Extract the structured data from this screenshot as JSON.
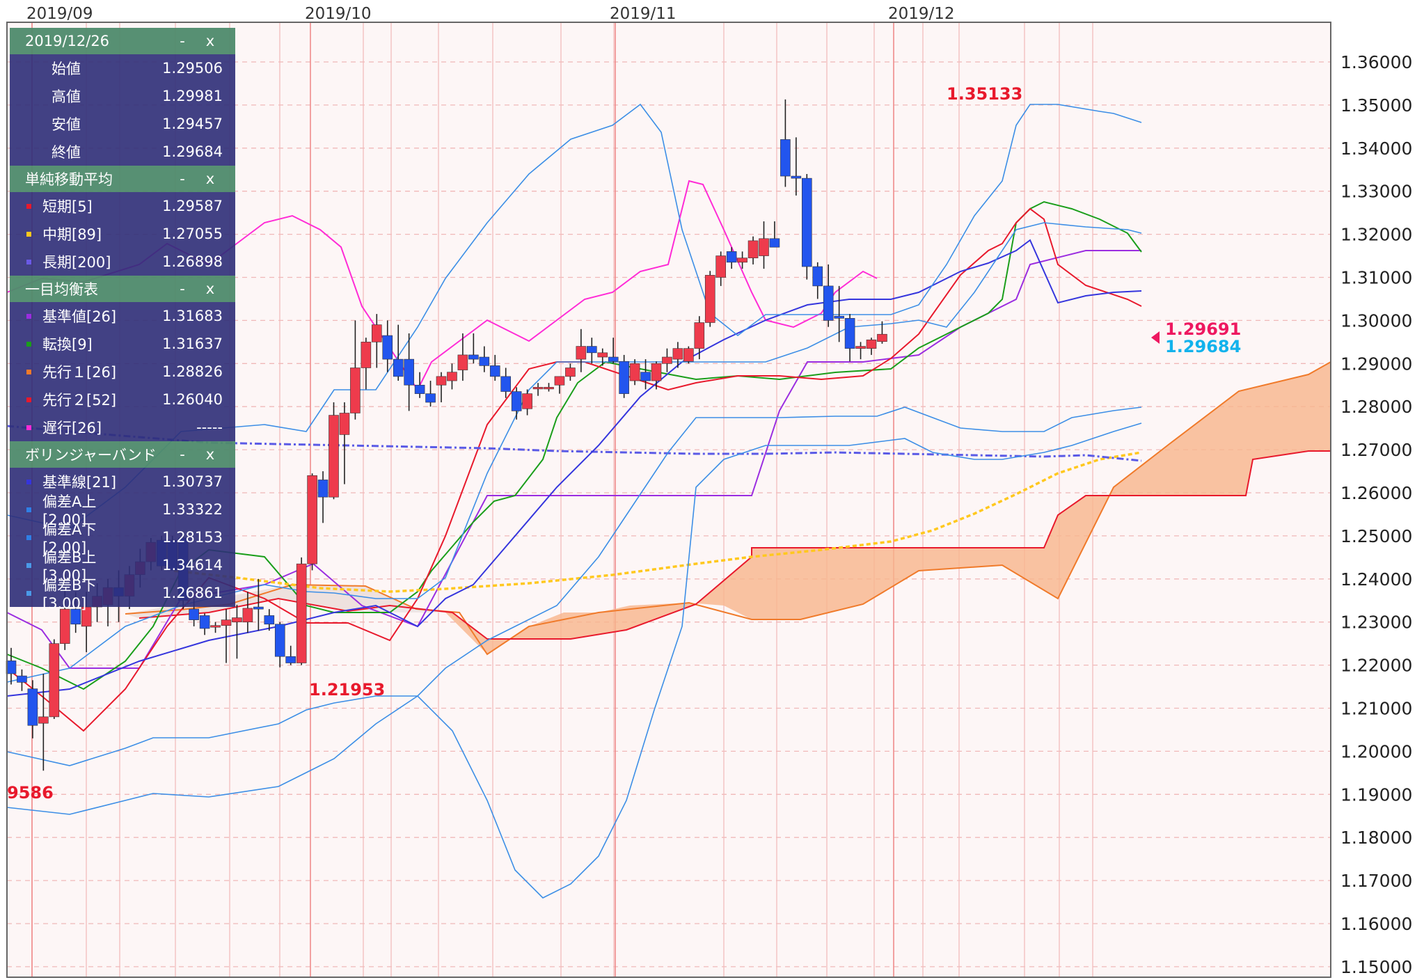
{
  "price_axis": {
    "ticks": [
      "1.36000",
      "1.35000",
      "1.34000",
      "1.33000",
      "1.32000",
      "1.31000",
      "1.30000",
      "1.29000",
      "1.28000",
      "1.27000",
      "1.26000",
      "1.25000",
      "1.24000",
      "1.23000",
      "1.22000",
      "1.21000",
      "1.20000",
      "1.19000",
      "1.18000",
      "1.17000",
      "1.16000",
      "1.15000"
    ]
  },
  "date_axis": {
    "labels": [
      "2019/09",
      "2019/10",
      "2019/11",
      "2019/12"
    ]
  },
  "annotations": {
    "high_label": "1.35133",
    "low_label": "1.21953",
    "left_low_label": "9586",
    "price_top": "1.29691",
    "price_bottom": "1.29684"
  },
  "colors": {
    "up_candle": "#ee3b4c",
    "down_candle": "#2255ee",
    "sma_short": "#e8192c",
    "sma_mid": "#ffc81e",
    "sma_long": "#5a5ae6",
    "kijun": "#9b2de0",
    "tenkan": "#1a9e1a",
    "senkou1": "#f07a2a",
    "senkou2": "#e8192c",
    "chikou": "#ff2bd6",
    "bb_basis": "#3535dd",
    "bb_band": "#3c8ee6",
    "cloud": "#f7b58c",
    "price_top": "#ee1860",
    "price_bottom": "#12b2ec"
  },
  "legend": {
    "ohlc": {
      "title": "2019/12/26",
      "rows": [
        {
          "label": "始値",
          "value": "1.29506"
        },
        {
          "label": "高値",
          "value": "1.29981"
        },
        {
          "label": "安値",
          "value": "1.29457"
        },
        {
          "label": "終値",
          "value": "1.29684"
        }
      ]
    },
    "sma": {
      "title": "単純移動平均",
      "rows": [
        {
          "label": "短期[5]",
          "value": "1.29587",
          "color": "#e8192c"
        },
        {
          "label": "中期[89]",
          "value": "1.27055",
          "color": "#ffc81e"
        },
        {
          "label": "長期[200]",
          "value": "1.26898",
          "color": "#6a5ae6"
        }
      ]
    },
    "ichimoku": {
      "title": "一目均衡表",
      "rows": [
        {
          "label": "基準値[26]",
          "value": "1.31683",
          "color": "#9b2de0"
        },
        {
          "label": "転換[9]",
          "value": "1.31637",
          "color": "#1a9e1a"
        },
        {
          "label": "先行１[26]",
          "value": "1.28826",
          "color": "#f07a2a"
        },
        {
          "label": "先行２[52]",
          "value": "1.26040",
          "color": "#e8192c"
        },
        {
          "label": "遅行[26]",
          "value": "-----",
          "color": "#ff2bd6"
        }
      ]
    },
    "bollinger": {
      "title": "ボリンジャーバンド",
      "rows": [
        {
          "label": "基準線[21]",
          "value": "1.30737",
          "color": "#3535dd"
        },
        {
          "label": "偏差A上[2.00]",
          "value": "1.33322",
          "color": "#2f7fe6"
        },
        {
          "label": "偏差A下[2.00]",
          "value": "1.28153",
          "color": "#2f7fe6"
        },
        {
          "label": "偏差B上[3.00]",
          "value": "1.34614",
          "color": "#4a9ae8"
        },
        {
          "label": "偏差B下[3.00]",
          "value": "1.26861",
          "color": "#4a9ae8"
        }
      ]
    },
    "buttons": {
      "minimize": "-",
      "close": "x"
    }
  },
  "chart_data": {
    "type": "candlestick",
    "instrument_note": "",
    "ylim": [
      1.15,
      1.3655
    ],
    "candles": [
      {
        "o": 1.221,
        "h": 1.224,
        "l": 1.2155,
        "c": 1.218
      },
      {
        "o": 1.2175,
        "h": 1.219,
        "l": 1.214,
        "c": 1.216
      },
      {
        "o": 1.2145,
        "h": 1.2165,
        "l": 1.203,
        "c": 1.206
      },
      {
        "o": 1.2065,
        "h": 1.218,
        "l": 1.1955,
        "c": 1.208
      },
      {
        "o": 1.208,
        "h": 1.226,
        "l": 1.2075,
        "c": 1.225
      },
      {
        "o": 1.225,
        "h": 1.241,
        "l": 1.2235,
        "c": 1.233
      },
      {
        "o": 1.233,
        "h": 1.237,
        "l": 1.2275,
        "c": 1.2295
      },
      {
        "o": 1.229,
        "h": 1.237,
        "l": 1.223,
        "c": 1.2335
      },
      {
        "o": 1.2335,
        "h": 1.239,
        "l": 1.23,
        "c": 1.236
      },
      {
        "o": 1.234,
        "h": 1.24,
        "l": 1.229,
        "c": 1.238
      },
      {
        "o": 1.238,
        "h": 1.242,
        "l": 1.23,
        "c": 1.236
      },
      {
        "o": 1.236,
        "h": 1.243,
        "l": 1.233,
        "c": 1.241
      },
      {
        "o": 1.241,
        "h": 1.247,
        "l": 1.238,
        "c": 1.244
      },
      {
        "o": 1.244,
        "h": 1.2495,
        "l": 1.242,
        "c": 1.2485
      },
      {
        "o": 1.249,
        "h": 1.25,
        "l": 1.242,
        "c": 1.243
      },
      {
        "o": 1.249,
        "h": 1.25,
        "l": 1.242,
        "c": 1.242
      },
      {
        "o": 1.2495,
        "h": 1.25,
        "l": 1.233,
        "c": 1.235
      },
      {
        "o": 1.233,
        "h": 1.2355,
        "l": 1.229,
        "c": 1.2305
      },
      {
        "o": 1.2315,
        "h": 1.232,
        "l": 1.227,
        "c": 1.2285
      },
      {
        "o": 1.229,
        "h": 1.23,
        "l": 1.2275,
        "c": 1.2292
      },
      {
        "o": 1.2292,
        "h": 1.233,
        "l": 1.2205,
        "c": 1.2305
      },
      {
        "o": 1.23,
        "h": 1.234,
        "l": 1.2215,
        "c": 1.231
      },
      {
        "o": 1.23,
        "h": 1.237,
        "l": 1.2275,
        "c": 1.2332
      },
      {
        "o": 1.2335,
        "h": 1.24,
        "l": 1.228,
        "c": 1.233
      },
      {
        "o": 1.2315,
        "h": 1.233,
        "l": 1.228,
        "c": 1.2295
      },
      {
        "o": 1.2295,
        "h": 1.23,
        "l": 1.2195,
        "c": 1.222
      },
      {
        "o": 1.222,
        "h": 1.2245,
        "l": 1.22,
        "c": 1.2205
      },
      {
        "o": 1.2205,
        "h": 1.245,
        "l": 1.22,
        "c": 1.2435
      },
      {
        "o": 1.2435,
        "h": 1.2645,
        "l": 1.242,
        "c": 1.264
      },
      {
        "o": 1.263,
        "h": 1.265,
        "l": 1.253,
        "c": 1.259
      },
      {
        "o": 1.259,
        "h": 1.281,
        "l": 1.2585,
        "c": 1.278
      },
      {
        "o": 1.2735,
        "h": 1.281,
        "l": 1.262,
        "c": 1.2785
      },
      {
        "o": 1.2785,
        "h": 1.3,
        "l": 1.277,
        "c": 1.289
      },
      {
        "o": 1.289,
        "h": 1.296,
        "l": 1.284,
        "c": 1.295
      },
      {
        "o": 1.295,
        "h": 1.3015,
        "l": 1.289,
        "c": 1.299
      },
      {
        "o": 1.2965,
        "h": 1.3,
        "l": 1.288,
        "c": 1.291
      },
      {
        "o": 1.291,
        "h": 1.299,
        "l": 1.286,
        "c": 1.287
      },
      {
        "o": 1.291,
        "h": 1.297,
        "l": 1.279,
        "c": 1.285
      },
      {
        "o": 1.285,
        "h": 1.288,
        "l": 1.282,
        "c": 1.283
      },
      {
        "o": 1.283,
        "h": 1.286,
        "l": 1.28,
        "c": 1.281
      },
      {
        "o": 1.285,
        "h": 1.288,
        "l": 1.281,
        "c": 1.287
      },
      {
        "o": 1.286,
        "h": 1.29,
        "l": 1.284,
        "c": 1.288
      },
      {
        "o": 1.2885,
        "h": 1.297,
        "l": 1.286,
        "c": 1.292
      },
      {
        "o": 1.292,
        "h": 1.297,
        "l": 1.29,
        "c": 1.291
      },
      {
        "o": 1.2915,
        "h": 1.294,
        "l": 1.288,
        "c": 1.2895
      },
      {
        "o": 1.2895,
        "h": 1.292,
        "l": 1.286,
        "c": 1.287
      },
      {
        "o": 1.287,
        "h": 1.289,
        "l": 1.282,
        "c": 1.2835
      },
      {
        "o": 1.2835,
        "h": 1.2845,
        "l": 1.277,
        "c": 1.279
      },
      {
        "o": 1.2795,
        "h": 1.284,
        "l": 1.278,
        "c": 1.283
      },
      {
        "o": 1.2845,
        "h": 1.2855,
        "l": 1.2825,
        "c": 1.2845
      },
      {
        "o": 1.2845,
        "h": 1.2855,
        "l": 1.2835,
        "c": 1.2845
      },
      {
        "o": 1.285,
        "h": 1.287,
        "l": 1.283,
        "c": 1.287
      },
      {
        "o": 1.287,
        "h": 1.29,
        "l": 1.286,
        "c": 1.289
      },
      {
        "o": 1.291,
        "h": 1.298,
        "l": 1.288,
        "c": 1.294
      },
      {
        "o": 1.294,
        "h": 1.296,
        "l": 1.29,
        "c": 1.2925
      },
      {
        "o": 1.2915,
        "h": 1.2935,
        "l": 1.2895,
        "c": 1.2925
      },
      {
        "o": 1.2915,
        "h": 1.296,
        "l": 1.29,
        "c": 1.2905
      },
      {
        "o": 1.2905,
        "h": 1.292,
        "l": 1.282,
        "c": 1.283
      },
      {
        "o": 1.286,
        "h": 1.291,
        "l": 1.285,
        "c": 1.29
      },
      {
        "o": 1.288,
        "h": 1.291,
        "l": 1.284,
        "c": 1.286
      },
      {
        "o": 1.286,
        "h": 1.2905,
        "l": 1.284,
        "c": 1.29
      },
      {
        "o": 1.29,
        "h": 1.2935,
        "l": 1.288,
        "c": 1.2915
      },
      {
        "o": 1.291,
        "h": 1.295,
        "l": 1.289,
        "c": 1.2935
      },
      {
        "o": 1.2905,
        "h": 1.294,
        "l": 1.29,
        "c": 1.2935
      },
      {
        "o": 1.2935,
        "h": 1.301,
        "l": 1.291,
        "c": 1.2995
      },
      {
        "o": 1.2995,
        "h": 1.3115,
        "l": 1.2985,
        "c": 1.3105
      },
      {
        "o": 1.31,
        "h": 1.316,
        "l": 1.308,
        "c": 1.315
      },
      {
        "o": 1.316,
        "h": 1.317,
        "l": 1.312,
        "c": 1.3135
      },
      {
        "o": 1.3135,
        "h": 1.316,
        "l": 1.312,
        "c": 1.3145
      },
      {
        "o": 1.3145,
        "h": 1.3195,
        "l": 1.313,
        "c": 1.3185
      },
      {
        "o": 1.315,
        "h": 1.323,
        "l": 1.312,
        "c": 1.319
      },
      {
        "o": 1.319,
        "h": 1.323,
        "l": 1.317,
        "c": 1.317
      },
      {
        "o": 1.342,
        "h": 1.3513,
        "l": 1.331,
        "c": 1.3335
      },
      {
        "o": 1.3335,
        "h": 1.3425,
        "l": 1.329,
        "c": 1.333
      },
      {
        "o": 1.333,
        "h": 1.334,
        "l": 1.3095,
        "c": 1.3125
      },
      {
        "o": 1.3125,
        "h": 1.3135,
        "l": 1.305,
        "c": 1.308
      },
      {
        "o": 1.308,
        "h": 1.313,
        "l": 1.2985,
        "c": 1.3
      },
      {
        "o": 1.301,
        "h": 1.308,
        "l": 1.295,
        "c": 1.3005
      },
      {
        "o": 1.3005,
        "h": 1.3015,
        "l": 1.2905,
        "c": 1.2935
      },
      {
        "o": 1.2935,
        "h": 1.295,
        "l": 1.291,
        "c": 1.294
      },
      {
        "o": 1.2935,
        "h": 1.296,
        "l": 1.292,
        "c": 1.2955
      },
      {
        "o": 1.2951,
        "h": 1.2998,
        "l": 1.2946,
        "c": 1.2968
      }
    ]
  }
}
